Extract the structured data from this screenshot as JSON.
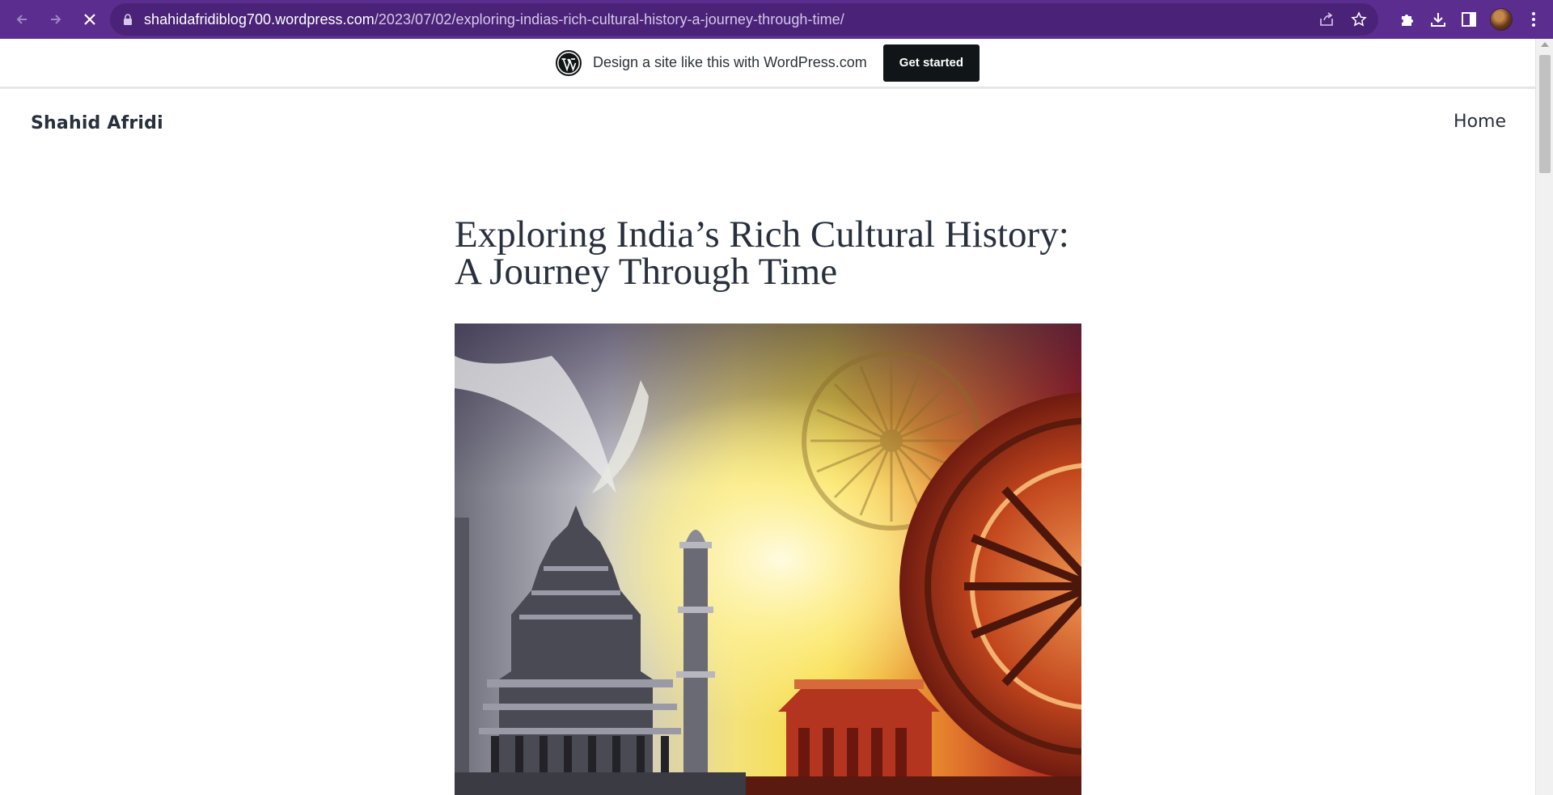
{
  "browser": {
    "url_host": "shahidafridiblog700.wordpress.com",
    "url_path": "/2023/07/02/exploring-indias-rich-cultural-history-a-journey-through-time/",
    "accent_color": "#5b2d8e"
  },
  "wp_banner": {
    "text": "Design a site like this with WordPress.com",
    "button_label": "Get started"
  },
  "site": {
    "title": "Shahid Afridi",
    "nav": [
      {
        "label": "Home"
      }
    ]
  },
  "post": {
    "title": "Exploring India’s Rich Cultural History: A Journey Through Time",
    "featured_image_icon": "featured-image"
  },
  "icons": {
    "back": "back-arrow-icon",
    "forward": "forward-arrow-icon",
    "stop": "stop-loading-icon",
    "lock": "lock-icon",
    "share": "share-icon",
    "bookmark": "star-icon",
    "extensions": "puzzle-icon",
    "downloads": "download-icon",
    "sidepanel": "side-panel-icon",
    "menu": "kebab-menu-icon"
  }
}
